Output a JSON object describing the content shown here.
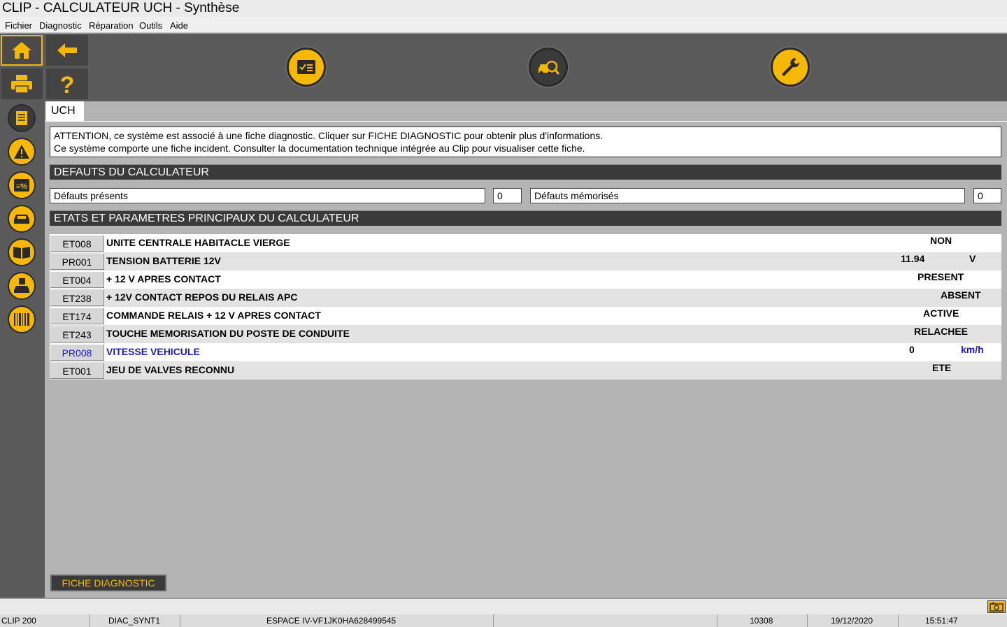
{
  "window": {
    "title": "CLIP - CALCULATEUR UCH - Synthèse"
  },
  "menu": [
    "Fichier",
    "Diagnostic",
    "Réparation",
    "Outils",
    "Aide"
  ],
  "tab": "UCH",
  "warning": {
    "line1": "ATTENTION, ce système est associé à une fiche diagnostic. Cliquer sur FICHE DIAGNOSTIC pour obtenir plus d'informations.",
    "line2": "Ce système comporte une fiche incident. Consulter la documentation technique intégrée au Clip pour visualiser cette fiche."
  },
  "defauts": {
    "header": "DEFAUTS DU CALCULATEUR",
    "present_label": "Défauts présents",
    "present_count": "0",
    "memorised_label": "Défauts mémorisés",
    "memorised_count": "0"
  },
  "etats": {
    "header": "ETATS ET PARAMETRES PRINCIPAUX DU CALCULATEUR",
    "rows": [
      {
        "code": "ET008",
        "label": "UNITE CENTRALE HABITACLE VIERGE",
        "value": "NON",
        "unit": ""
      },
      {
        "code": "PR001",
        "label": "TENSION BATTERIE 12V",
        "value": "11.94",
        "unit": "V"
      },
      {
        "code": "ET004",
        "label": "+ 12 V APRES CONTACT",
        "value": "PRESENT",
        "unit": ""
      },
      {
        "code": "ET238",
        "label": "+ 12V CONTACT REPOS DU RELAIS APC",
        "value": "ABSENT",
        "unit": ""
      },
      {
        "code": "ET174",
        "label": "COMMANDE RELAIS + 12 V APRES CONTACT",
        "value": "ACTIVE",
        "unit": ""
      },
      {
        "code": "ET243",
        "label": "TOUCHE MEMORISATION DU POSTE DE CONDUITE",
        "value": "RELACHEE",
        "unit": ""
      },
      {
        "code": "PR008",
        "label": "VITESSE VEHICULE",
        "value": "0",
        "unit": "km/h"
      },
      {
        "code": "ET001",
        "label": "JEU DE VALVES RECONNU",
        "value": "ETE",
        "unit": ""
      }
    ]
  },
  "fiche_button": "FICHE DIAGNOSTIC",
  "statusbar": {
    "device": "CLIP 200",
    "screen": "DIAC_SYNT1",
    "vehicle": "ESPACE IV-VF1JK0HA628499545",
    "code": "10308",
    "date": "19/12/2020",
    "time": "15:51:47"
  },
  "colors": {
    "accent": "#f6b800",
    "highlight_text": "#1a1acc"
  }
}
